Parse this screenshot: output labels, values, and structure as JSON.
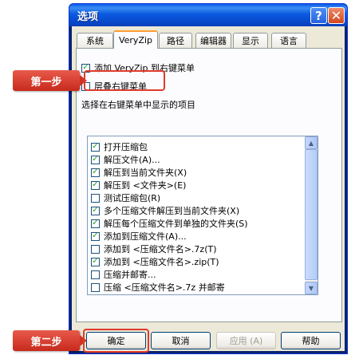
{
  "window": {
    "title": "选项"
  },
  "tabs": [
    "系统",
    "VeryZip",
    "路径",
    "编辑器",
    "显示",
    "语言"
  ],
  "options": {
    "add_to_context_menu": {
      "label": "添加 VeryZip 到右键菜单",
      "checked": true
    },
    "cascade_context_menu": {
      "label": "层叠右键菜单",
      "checked": false
    }
  },
  "menu_items_label": "选择在右键菜单中显示的项目",
  "menu_items": [
    {
      "label": "打开压缩包",
      "checked": true
    },
    {
      "label": "解压文件(A)...",
      "checked": true
    },
    {
      "label": "解压到当前文件夹(X)",
      "checked": true
    },
    {
      "label": "解压到 <文件夹>(E)",
      "checked": true
    },
    {
      "label": "测试压缩包(R)",
      "checked": false
    },
    {
      "label": "多个压缩文件解压到当前文件夹(X)",
      "checked": true
    },
    {
      "label": "解压每个压缩文件到单独的文件夹(S)",
      "checked": true
    },
    {
      "label": "添加到压缩文件(A)...",
      "checked": true
    },
    {
      "label": "添加到 <压缩文件名>.7z(T)",
      "checked": false
    },
    {
      "label": "添加到 <压缩文件名>.zip(T)",
      "checked": true
    },
    {
      "label": "压缩并邮寄...",
      "checked": false
    },
    {
      "label": "压缩 <压缩文件名>.7z 并邮寄",
      "checked": false
    }
  ],
  "buttons": {
    "ok": "确定",
    "cancel": "取消",
    "apply": "应用 (A)",
    "help": "帮助"
  },
  "callouts": {
    "step1": "第一步",
    "step2": "第二步"
  },
  "icons": {
    "check": "✓",
    "help": "?",
    "close": "✕",
    "scroll_up": "▲",
    "scroll_down": "▼"
  }
}
